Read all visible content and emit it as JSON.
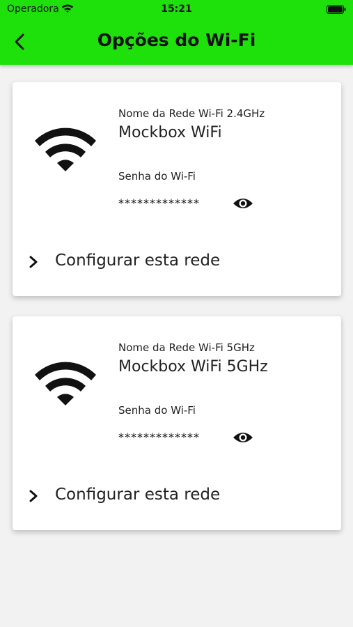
{
  "status_bar": {
    "carrier": "Operadora",
    "time": "15:21",
    "wifi_icon": "wifi-signal-icon",
    "battery_icon": "battery-full-icon"
  },
  "header": {
    "title": "Opções do Wi-Fi",
    "back_icon": "chevron-left-icon",
    "color": "#1ee10b"
  },
  "networks": [
    {
      "network_label": "Nome da Rede Wi-Fi 2.4GHz",
      "network_name": "Mockbox WiFi",
      "password_label": "Senha do Wi-Fi",
      "password_value": "*************",
      "configure_label": "Configurar esta rede"
    },
    {
      "network_label": "Nome da Rede Wi-Fi 5GHz",
      "network_name": "Mockbox WiFi 5GHz",
      "password_label": "Senha do Wi-Fi",
      "password_value": "*************",
      "configure_label": "Configurar esta rede"
    }
  ]
}
